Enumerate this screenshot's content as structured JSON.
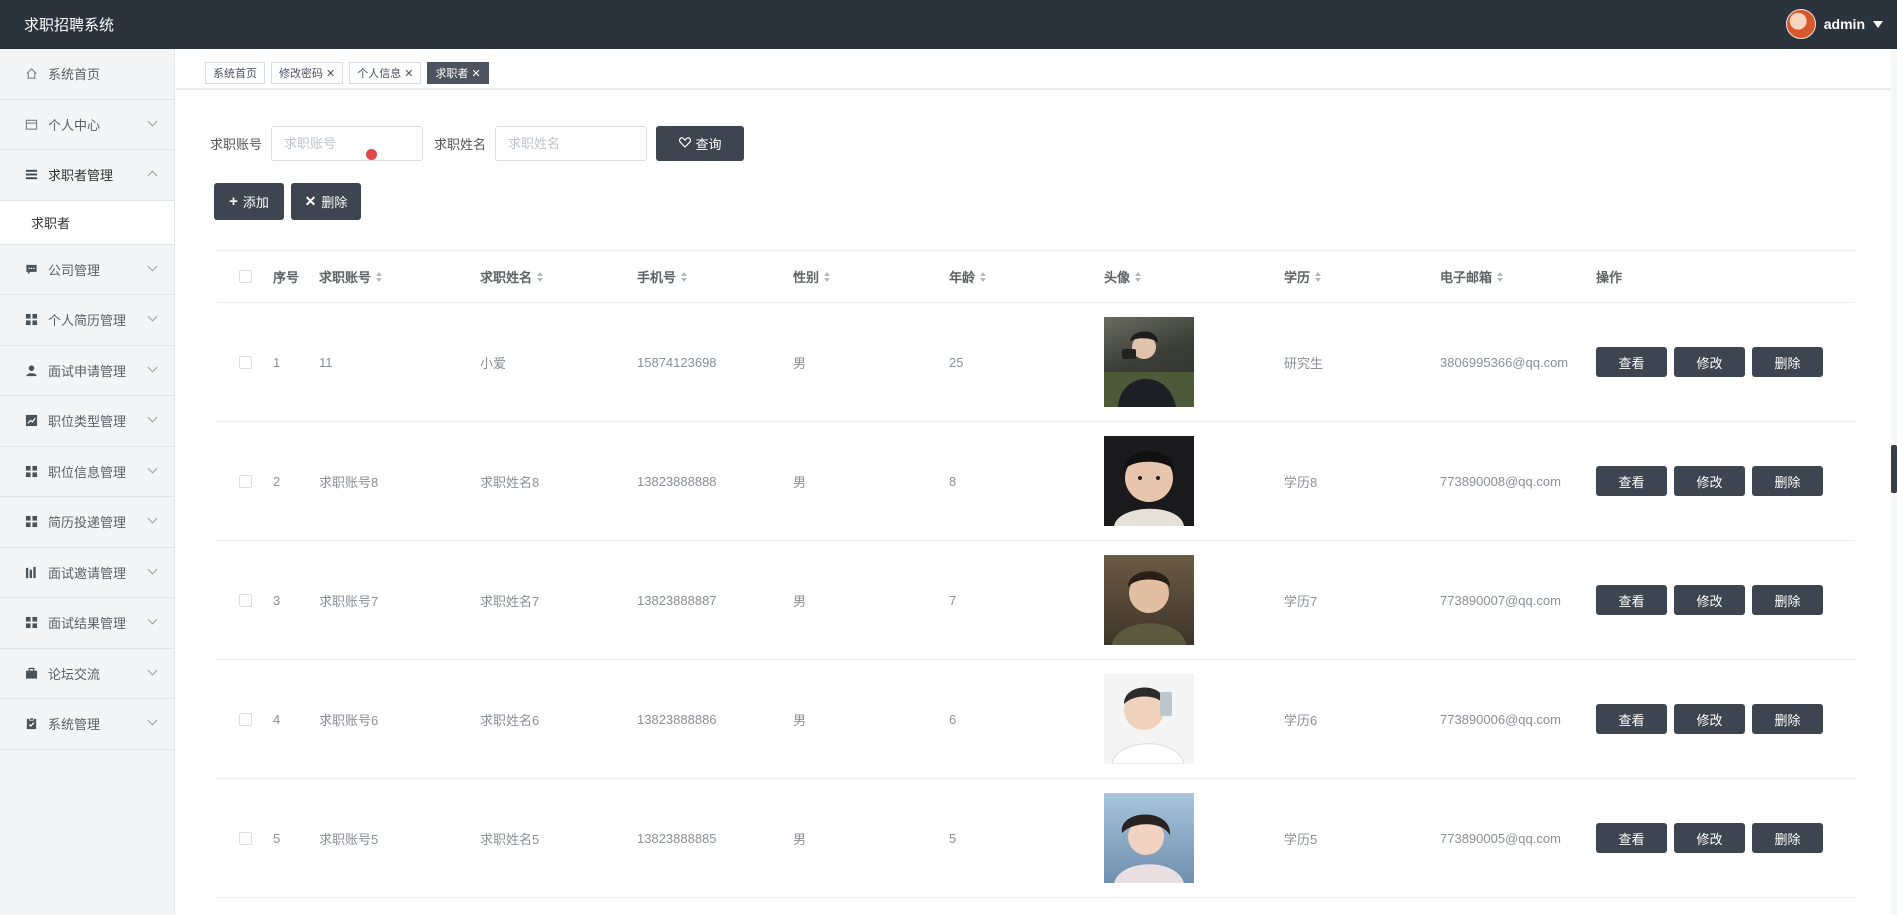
{
  "app": {
    "title": "求职招聘系统",
    "user": "admin"
  },
  "sidebar": {
    "items": [
      {
        "label": "系统首页",
        "icon": "home-icon",
        "has_children": false
      },
      {
        "label": "个人中心",
        "icon": "calendar-icon",
        "has_children": true
      },
      {
        "label": "求职者管理",
        "icon": "list-icon",
        "has_children": true,
        "open": true
      },
      {
        "label": "公司管理",
        "icon": "chat-icon",
        "has_children": true
      },
      {
        "label": "个人简历管理",
        "icon": "grid-icon",
        "has_children": true
      },
      {
        "label": "面试申请管理",
        "icon": "user-icon",
        "has_children": true
      },
      {
        "label": "职位类型管理",
        "icon": "chart-icon",
        "has_children": true
      },
      {
        "label": "职位信息管理",
        "icon": "grid-icon",
        "has_children": true
      },
      {
        "label": "简历投递管理",
        "icon": "grid-icon",
        "has_children": true
      },
      {
        "label": "面试邀请管理",
        "icon": "bar-chart-icon",
        "has_children": true
      },
      {
        "label": "面试结果管理",
        "icon": "grid-icon",
        "has_children": true
      },
      {
        "label": "论坛交流",
        "icon": "briefcase-icon",
        "has_children": true
      },
      {
        "label": "系统管理",
        "icon": "clipboard-icon",
        "has_children": true
      }
    ],
    "sub_item": "求职者"
  },
  "tags": [
    {
      "label": "系统首页",
      "closable": false,
      "active": false
    },
    {
      "label": "修改密码",
      "closable": true,
      "active": false
    },
    {
      "label": "个人信息",
      "closable": true,
      "active": false
    },
    {
      "label": "求职者",
      "closable": true,
      "active": true
    }
  ],
  "search": {
    "account_label": "求职账号",
    "account_placeholder": "求职账号",
    "name_label": "求职姓名",
    "name_placeholder": "求职姓名",
    "query_button": "查询"
  },
  "actions": {
    "add": "添加",
    "delete": "删除"
  },
  "table": {
    "headers": {
      "idx": "序号",
      "account": "求职账号",
      "name": "求职姓名",
      "phone": "手机号",
      "sex": "性别",
      "age": "年龄",
      "avatar": "头像",
      "edu": "学历",
      "email": "电子邮箱",
      "op": "操作"
    },
    "row_buttons": {
      "view": "查看",
      "edit": "修改",
      "delete": "删除"
    },
    "rows": [
      {
        "idx": "1",
        "account": "11",
        "name": "小爱",
        "phone": "15874123698",
        "sex": "男",
        "age": "25",
        "edu": "研究生",
        "email": "3806995366@qq.com"
      },
      {
        "idx": "2",
        "account": "求职账号8",
        "name": "求职姓名8",
        "phone": "13823888888",
        "sex": "男",
        "age": "8",
        "edu": "学历8",
        "email": "773890008@qq.com"
      },
      {
        "idx": "3",
        "account": "求职账号7",
        "name": "求职姓名7",
        "phone": "13823888887",
        "sex": "男",
        "age": "7",
        "edu": "学历7",
        "email": "773890007@qq.com"
      },
      {
        "idx": "4",
        "account": "求职账号6",
        "name": "求职姓名6",
        "phone": "13823888886",
        "sex": "男",
        "age": "6",
        "edu": "学历6",
        "email": "773890006@qq.com"
      },
      {
        "idx": "5",
        "account": "求职账号5",
        "name": "求职姓名5",
        "phone": "13823888885",
        "sex": "男",
        "age": "5",
        "edu": "学历5",
        "email": "773890005@qq.com"
      }
    ]
  },
  "colors": {
    "header": "#2b333d",
    "button": "#3d4650",
    "sidebar": "#f4f5f6"
  }
}
